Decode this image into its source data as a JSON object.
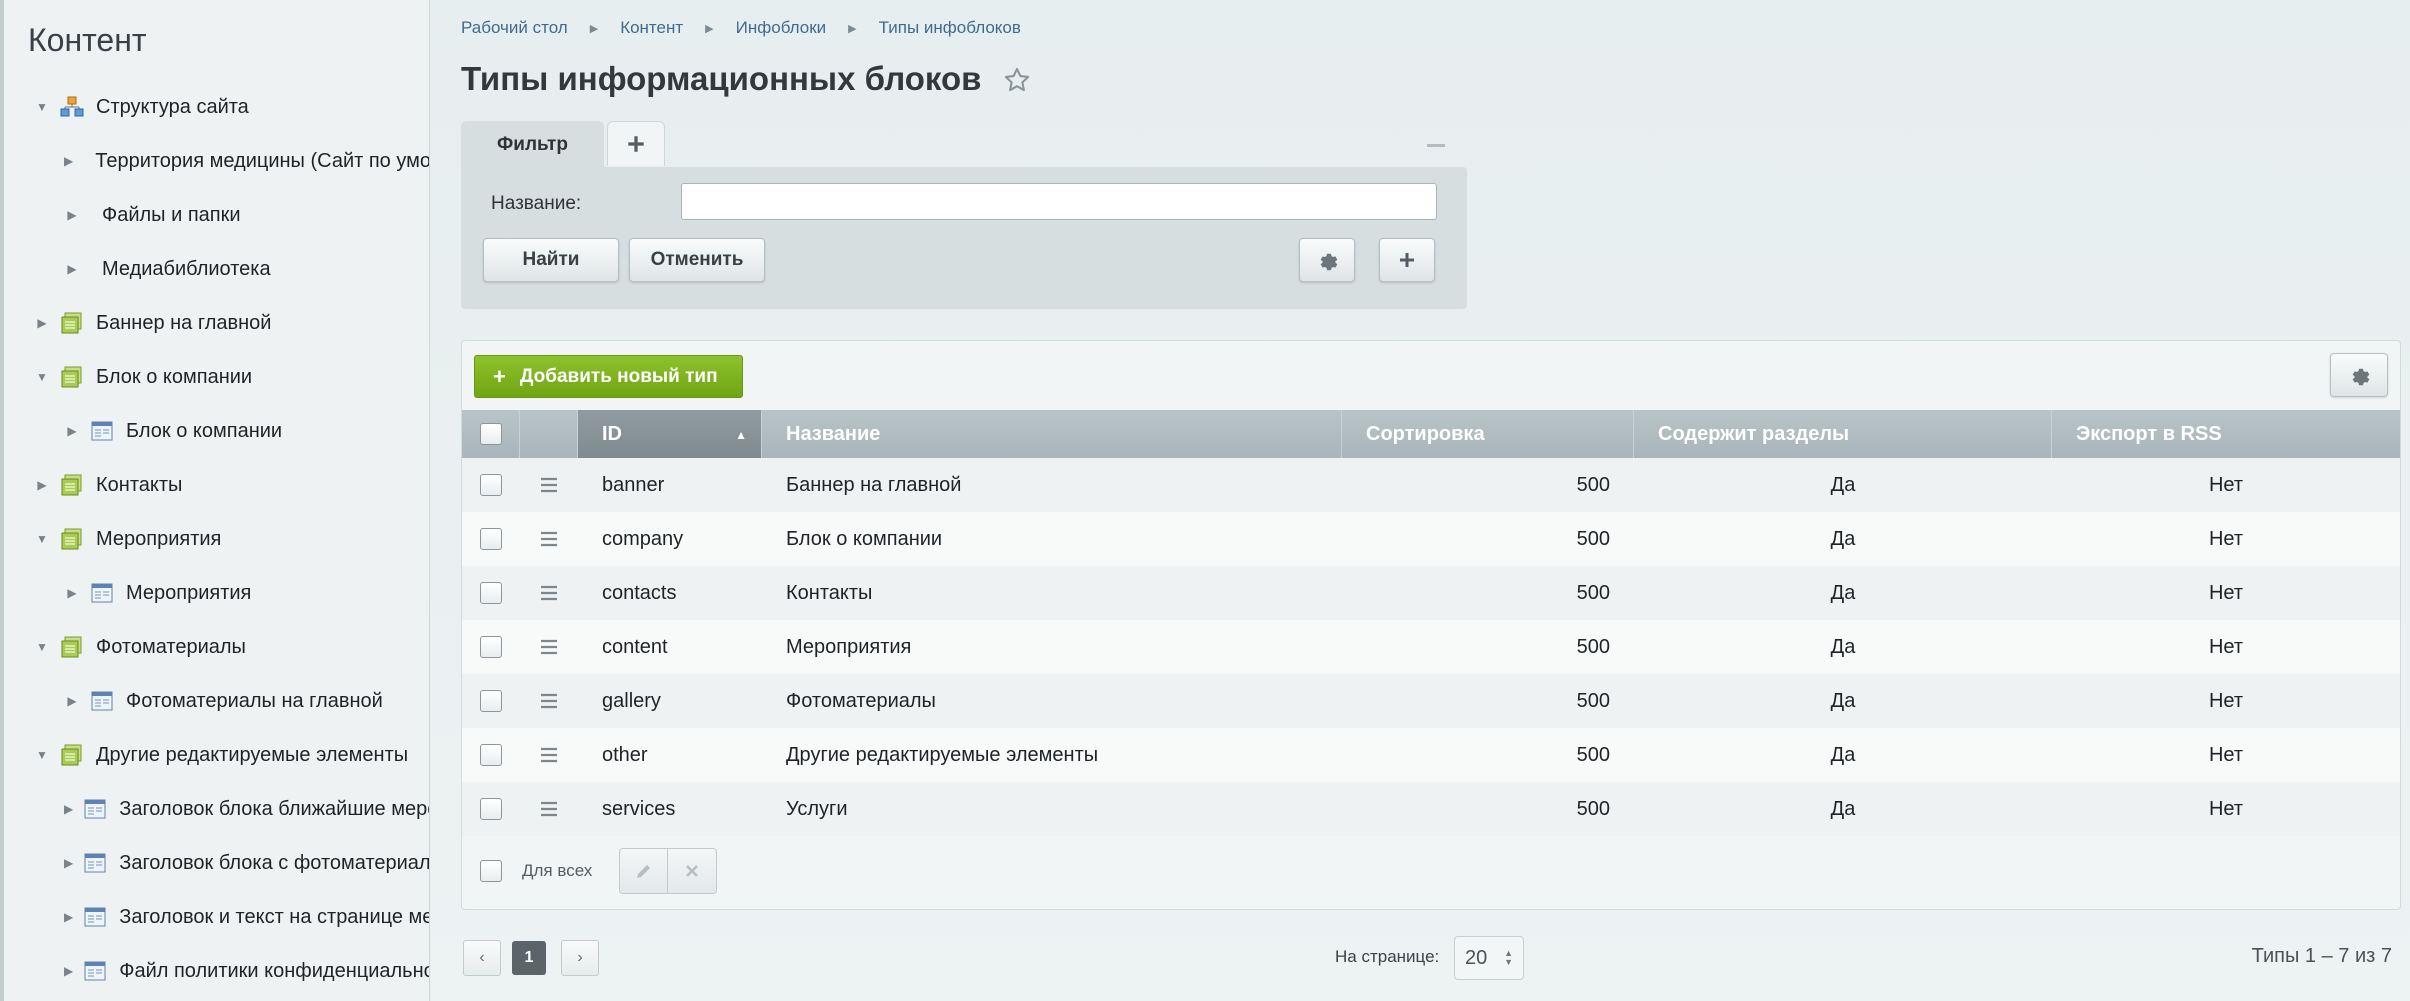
{
  "sidebar": {
    "title": "Контент",
    "items": [
      {
        "label": "Структура сайта",
        "toggle": "expanded",
        "icon": "site-structure-icon"
      },
      {
        "label": "Территория медицины (Сайт по умол",
        "toggle": "collapsed",
        "icon": ""
      },
      {
        "label": "Файлы и папки",
        "toggle": "collapsed",
        "icon": ""
      },
      {
        "label": "Медиабиблиотека",
        "toggle": "collapsed",
        "icon": ""
      },
      {
        "label": "Баннер на главной",
        "toggle": "collapsed",
        "icon": "iblock-type-icon"
      },
      {
        "label": "Блок о компании",
        "toggle": "expanded",
        "icon": "iblock-type-icon"
      },
      {
        "label": "Блок о компании",
        "toggle": "collapsed",
        "icon": "iblock-icon"
      },
      {
        "label": "Контакты",
        "toggle": "collapsed",
        "icon": "iblock-type-icon"
      },
      {
        "label": "Мероприятия",
        "toggle": "expanded",
        "icon": "iblock-type-icon"
      },
      {
        "label": "Мероприятия",
        "toggle": "collapsed",
        "icon": "iblock-icon"
      },
      {
        "label": "Фотоматериалы",
        "toggle": "expanded",
        "icon": "iblock-type-icon"
      },
      {
        "label": "Фотоматериалы на главной",
        "toggle": "collapsed",
        "icon": "iblock-icon"
      },
      {
        "label": "Другие редактируемые элементы",
        "toggle": "expanded",
        "icon": "iblock-type-icon"
      },
      {
        "label": "Заголовок блока ближайшие меро",
        "toggle": "collapsed",
        "icon": "iblock-icon"
      },
      {
        "label": "Заголовок блока с фотоматериал",
        "toggle": "collapsed",
        "icon": "iblock-icon"
      },
      {
        "label": "Заголовок и текст на странице ме",
        "toggle": "collapsed",
        "icon": "iblock-icon"
      },
      {
        "label": "Файл политики конфиденциально",
        "toggle": "collapsed",
        "icon": "iblock-icon"
      }
    ]
  },
  "breadcrumbs": [
    "Рабочий стол",
    "Контент",
    "Инфоблоки",
    "Типы инфоблоков"
  ],
  "page": {
    "title": "Типы информационных блоков"
  },
  "filter": {
    "tab_label": "Фильтр",
    "name_label": "Название:",
    "name_value": "",
    "find_label": "Найти",
    "cancel_label": "Отменить"
  },
  "grid": {
    "add_label": "Добавить новый тип",
    "columns": [
      "ID",
      "Название",
      "Сортировка",
      "Содержит разделы",
      "Экспорт в RSS"
    ],
    "rows": [
      {
        "id": "banner",
        "name": "Баннер на главной",
        "sort": "500",
        "sections": "Да",
        "rss": "Нет"
      },
      {
        "id": "company",
        "name": "Блок о компании",
        "sort": "500",
        "sections": "Да",
        "rss": "Нет"
      },
      {
        "id": "contacts",
        "name": "Контакты",
        "sort": "500",
        "sections": "Да",
        "rss": "Нет"
      },
      {
        "id": "content",
        "name": "Мероприятия",
        "sort": "500",
        "sections": "Да",
        "rss": "Нет"
      },
      {
        "id": "gallery",
        "name": "Фотоматериалы",
        "sort": "500",
        "sections": "Да",
        "rss": "Нет"
      },
      {
        "id": "other",
        "name": "Другие редактируемые элементы",
        "sort": "500",
        "sections": "Да",
        "rss": "Нет"
      },
      {
        "id": "services",
        "name": "Услуги",
        "sort": "500",
        "sections": "Да",
        "rss": "Нет"
      }
    ],
    "for_all_label": "Для всех"
  },
  "pagination": {
    "current_page": "1",
    "per_page_label": "На странице:",
    "per_page_value": "20",
    "total_label": "Типы 1 – 7 из 7"
  },
  "colors": {
    "accent_green": "#7ab31d",
    "header_gray": "#aeb9be",
    "link_blue": "#3f6b8f"
  }
}
